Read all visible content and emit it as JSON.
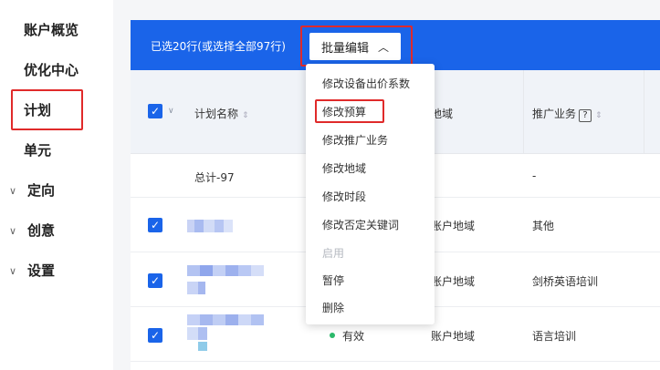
{
  "sidebar": {
    "items": [
      {
        "label": "账户概览"
      },
      {
        "label": "优化中心"
      },
      {
        "label": "计划"
      },
      {
        "label": "单元"
      },
      {
        "label": "定向"
      },
      {
        "label": "创意"
      },
      {
        "label": "设置"
      }
    ]
  },
  "bulkbar": {
    "selected_text": "已选20行(或选择全部97行)",
    "edit_button_label": "批量编辑"
  },
  "table": {
    "headers": {
      "plan_name": "计划名称",
      "region": "地域",
      "business": "推广业务"
    },
    "total_row": {
      "label": "总计-97",
      "business": "-"
    },
    "rows": [
      {
        "status": "",
        "region": "账户地域",
        "business": "其他"
      },
      {
        "status": "",
        "region": "账户地域",
        "business": "剑桥英语培训"
      },
      {
        "status": "有效",
        "region": "账户地域",
        "business": "语言培训"
      }
    ]
  },
  "dropdown": {
    "items": [
      {
        "label": "修改设备出价系数",
        "enabled": true
      },
      {
        "label": "修改预算",
        "enabled": true
      },
      {
        "label": "修改推广业务",
        "enabled": true
      },
      {
        "label": "修改地域",
        "enabled": true
      },
      {
        "label": "修改时段",
        "enabled": true
      },
      {
        "label": "修改否定关键词",
        "enabled": true
      },
      {
        "label": "启用",
        "enabled": false
      },
      {
        "label": "暂停",
        "enabled": true
      },
      {
        "label": "删除",
        "enabled": true
      }
    ]
  },
  "icons": {
    "checkbox": "check-icon",
    "sort": "sort-icon",
    "help": "help-icon",
    "collapse": "chevron-up-icon",
    "expand": "chevron-down-icon"
  },
  "colors": {
    "primary": "#1a64e9",
    "highlight_border": "#e02a2a",
    "status_active": "#2bb96a"
  }
}
